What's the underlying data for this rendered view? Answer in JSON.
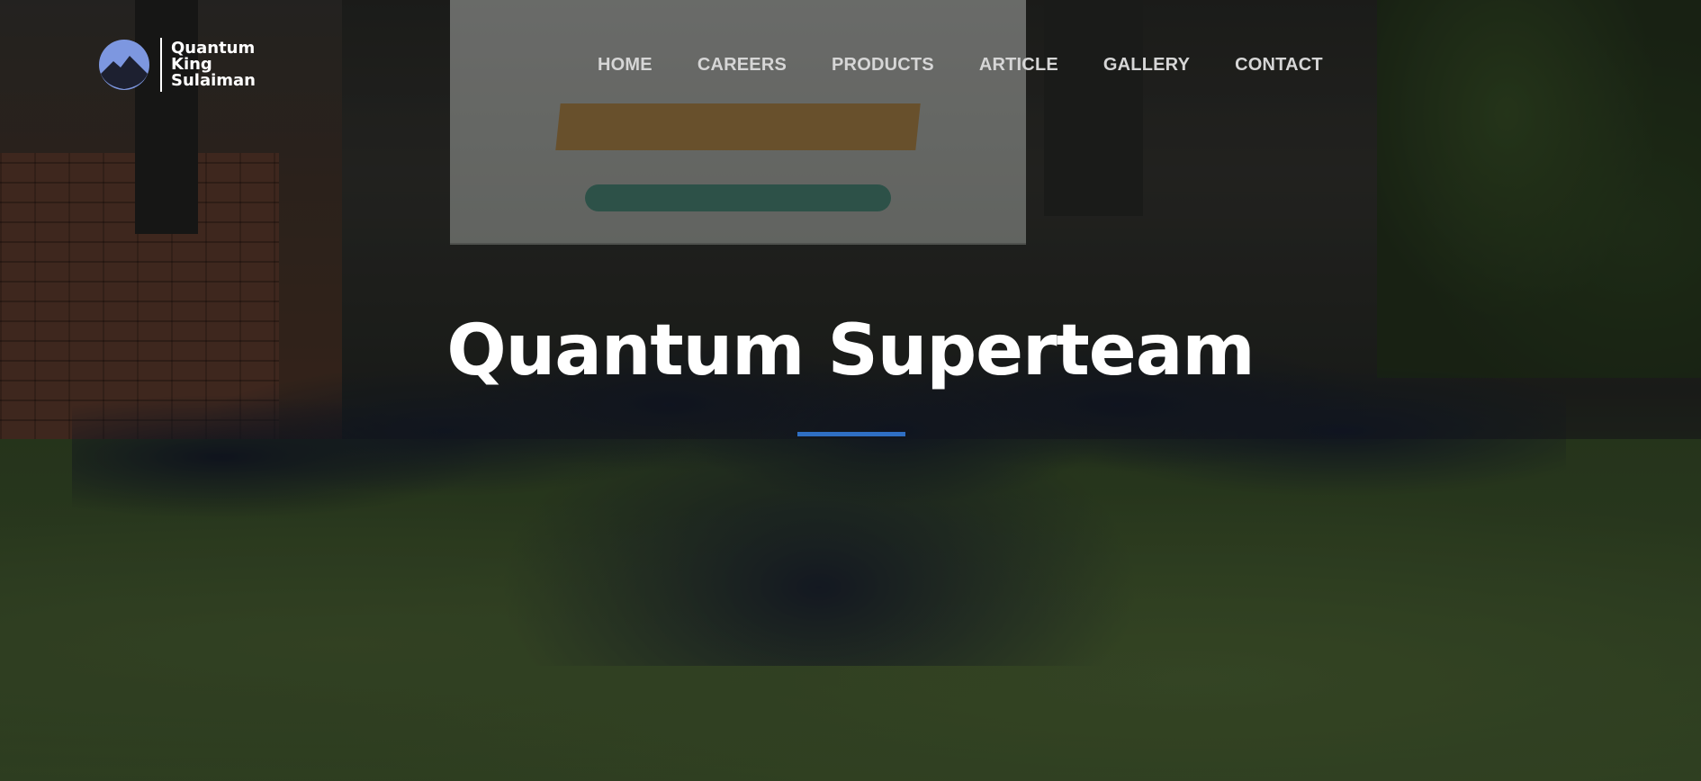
{
  "logo": {
    "lines": [
      "Quantum",
      "King",
      "Sulaiman"
    ],
    "mark_color": "#7d97e0"
  },
  "nav": {
    "items": [
      "HOME",
      "CAREERS",
      "PRODUCTS",
      "ARTICLE",
      "GALLERY",
      "CONTACT"
    ]
  },
  "hero": {
    "title": "Quantum Superteam",
    "accent_color": "#2f6fc4"
  }
}
